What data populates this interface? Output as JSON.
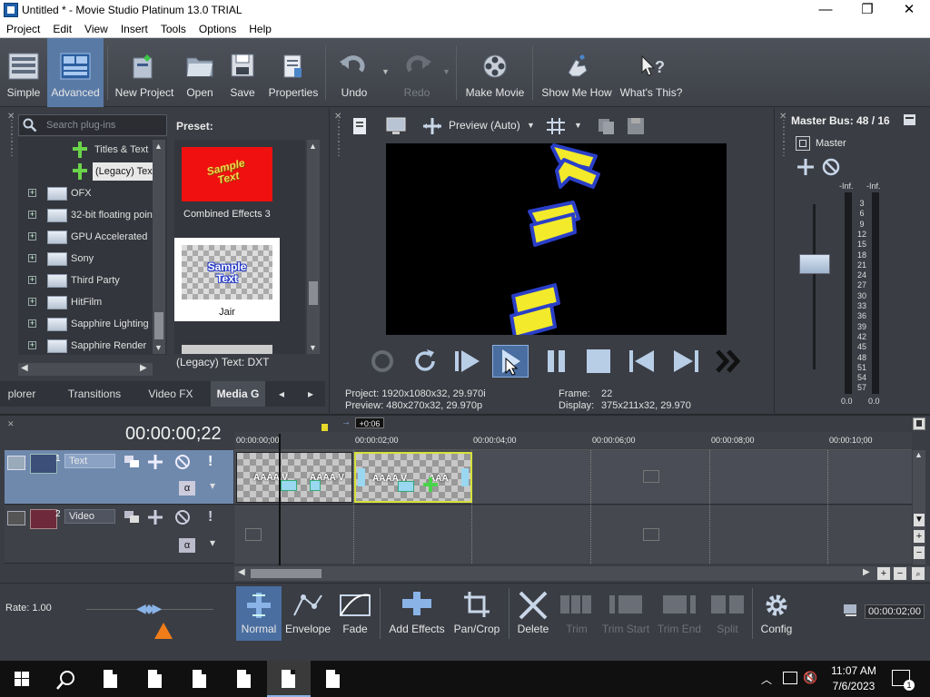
{
  "window": {
    "title": "Untitled * - Movie Studio Platinum 13.0 TRIAL"
  },
  "menu": [
    "Project",
    "Edit",
    "View",
    "Insert",
    "Tools",
    "Options",
    "Help"
  ],
  "toolbar": {
    "simple": "Simple",
    "advanced": "Advanced",
    "new_project": "New Project",
    "open": "Open",
    "save": "Save",
    "properties": "Properties",
    "undo": "Undo",
    "redo": "Redo",
    "make_movie": "Make Movie",
    "show_me_how": "Show Me How",
    "whats_this": "What's This?"
  },
  "plugins": {
    "search_placeholder": "Search plug-ins",
    "tree": [
      "Titles & Text",
      "(Legacy) Tex",
      "OFX",
      "32-bit floating poin",
      "GPU Accelerated",
      "Sony",
      "Third Party",
      "HitFilm",
      "Sapphire Lighting",
      "Sapphire Render"
    ],
    "preset_header": "Preset:",
    "presets": [
      {
        "name": "Combined Effects 3",
        "thumb_text": "Sample Text"
      },
      {
        "name": "Jair",
        "thumb_text": "Sample Text"
      }
    ],
    "selected_plugin": "(Legacy) Text: DXT"
  },
  "tabs": [
    "plorer",
    "Transitions",
    "Video FX",
    "Media G"
  ],
  "preview": {
    "mode": "Preview (Auto)",
    "project_label": "Project:",
    "project_value": "1920x1080x32, 29.970i",
    "preview_label": "Preview:",
    "preview_value": "480x270x32, 29.970p",
    "frame_label": "Frame:",
    "frame_value": "22",
    "display_label": "Display:",
    "display_value": "375x211x32, 29.970"
  },
  "master": {
    "title": "Master Bus: 48 / 16",
    "name": "Master",
    "left_peak": "-Inf.",
    "right_peak": "-Inf.",
    "scale": [
      "3",
      "6",
      "9",
      "12",
      "15",
      "18",
      "21",
      "24",
      "27",
      "30",
      "33",
      "36",
      "39",
      "42",
      "45",
      "48",
      "51",
      "54",
      "57"
    ],
    "left_level": "0.0",
    "right_level": "0.0"
  },
  "timeline": {
    "timecode": "00:00:00;22",
    "offset": "+0:06",
    "ruler": [
      "00:00:00;00",
      "00:00:02;00",
      "00:00:04;00",
      "00:00:06;00",
      "00:00:08;00",
      "00:00:10;00"
    ],
    "tracks": [
      {
        "number": "1",
        "name": "Text"
      },
      {
        "number": "2",
        "name": "Video"
      }
    ],
    "clip_text": [
      "AAAA V",
      "AAAA V",
      "AAAA V",
      "AAA"
    ]
  },
  "bottom": {
    "rate": "Rate: 1.00",
    "normal": "Normal",
    "envelope": "Envelope",
    "fade": "Fade",
    "add_effects": "Add Effects",
    "pan_crop": "Pan/Crop",
    "delete": "Delete",
    "trim": "Trim",
    "trim_start": "Trim Start",
    "trim_end": "Trim End",
    "split": "Split",
    "config": "Config",
    "end_time": "00:00:02;00"
  },
  "taskbar": {
    "time": "11:07 AM",
    "date": "7/6/2023",
    "notifications": "1"
  },
  "colors": {
    "accent": "#5a7aa6",
    "clip_border": "#d6e23a",
    "preview_text": "#f2ea2a",
    "preview_outline": "#2a3fc8"
  }
}
